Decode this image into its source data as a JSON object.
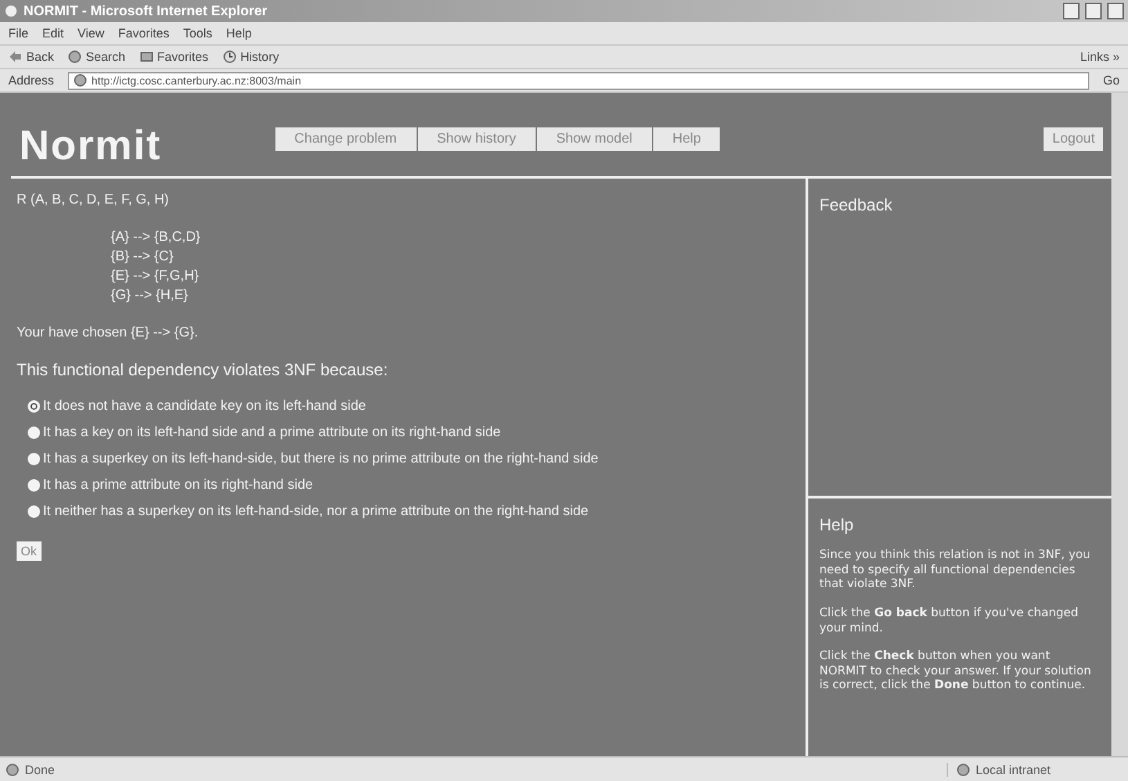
{
  "browser": {
    "title": "NORMIT - Microsoft Internet Explorer",
    "menu": [
      "File",
      "Edit",
      "View",
      "Favorites",
      "Tools",
      "Help"
    ],
    "toolbar": [
      {
        "kind": "back",
        "label": "Back"
      },
      {
        "kind": "search",
        "label": "Search"
      },
      {
        "kind": "favorites",
        "label": "Favorites"
      },
      {
        "kind": "history",
        "label": "History"
      }
    ],
    "links": "Links »",
    "address": {
      "label": "Address",
      "url": "http://ictg.cosc.canterbury.ac.nz:8003/main"
    },
    "go": "Go"
  },
  "app": {
    "logo": "Normit",
    "nav": [
      "Change problem",
      "Show history",
      "Show model",
      "Help"
    ],
    "logout": "Logout",
    "relation": "R  (A, B, C, D, E, F, G, H)",
    "dependencies": [
      "{A} --> {B,C,D}",
      "{B} --> {C}",
      "{E} --> {F,G,H}",
      "{G} --> {H,E}"
    ],
    "chosen": "Your have chosen {E} --> {G}.",
    "question": "This functional dependency violates 3NF because:",
    "options": [
      {
        "label": "It does not have a candidate key on its left-hand side",
        "selected": true
      },
      {
        "label": "It has a key on its left-hand side and a prime attribute on its right-hand side",
        "selected": false
      },
      {
        "label": "It has a superkey on its left-hand-side, but there is no prime attribute on the right-hand side",
        "selected": false
      },
      {
        "label": "It has a prime attribute on its right-hand side",
        "selected": false
      },
      {
        "label": "It neither has a superkey on its left-hand-side, nor a prime attribute on the right-hand side",
        "selected": false
      }
    ],
    "ok": "Ok",
    "feedback": {
      "title": "Feedback"
    },
    "help": {
      "title": "Help",
      "paragraphs": [
        "Since you think this relation is not in 3NF, you need to specify all functional dependencies that violate 3NF.",
        "Click the **Go back** button if you've changed your mind.",
        "Click the **Check** button when you want NORMIT to check your answer. If your solution is correct, click the **Done** button to continue."
      ]
    }
  },
  "status": {
    "text": "Done",
    "zone": "Local intranet"
  }
}
